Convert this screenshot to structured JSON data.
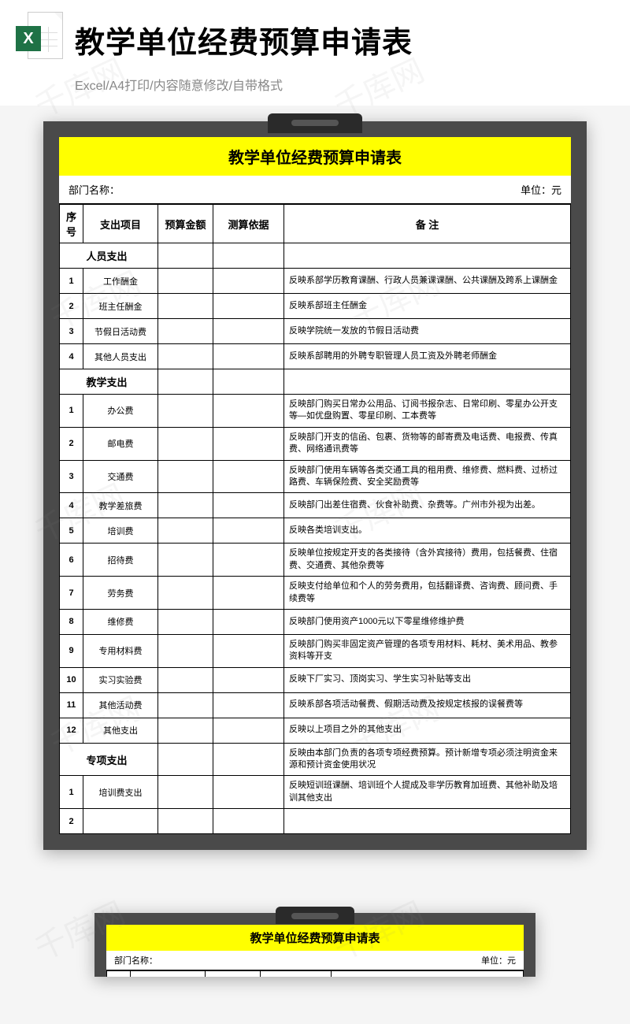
{
  "header": {
    "main_title": "教学单位经费预算申请表",
    "subtitle": "Excel/A4打印/内容随意修改/自带格式",
    "icon_letter": "X"
  },
  "sheet": {
    "title": "教学单位经费预算申请表",
    "dept_label": "部门名称：",
    "unit_label": "单位：元",
    "columns": {
      "num": "序号",
      "item": "支出项目",
      "amount": "预算金额",
      "basis": "测算依据",
      "note": "备  注"
    },
    "sections": [
      {
        "name": "人员支出",
        "note": "",
        "rows": [
          {
            "n": "1",
            "item": "工作酬金",
            "note": "反映系部学历教育课酬、行政人员兼课课酬、公共课酬及跨系上课酬金"
          },
          {
            "n": "2",
            "item": "班主任酬金",
            "note": "反映系部班主任酬金"
          },
          {
            "n": "3",
            "item": "节假日活动费",
            "note": "反映学院统一发放的节假日活动费"
          },
          {
            "n": "4",
            "item": "其他人员支出",
            "note": "反映系部聘用的外聘专职管理人员工资及外聘老师酬金"
          }
        ]
      },
      {
        "name": "教学支出",
        "note": "",
        "rows": [
          {
            "n": "1",
            "item": "办公费",
            "note": "反映部门购买日常办公用品、订阅书报杂志、日常印刷、零星办公开支等—如优盘购置、零星印刷、工本费等"
          },
          {
            "n": "2",
            "item": "邮电费",
            "note": "反映部门开支的信函、包裹、货物等的邮寄费及电话费、电报费、传真费、网络通讯费等"
          },
          {
            "n": "3",
            "item": "交通费",
            "note": "反映部门使用车辆等各类交通工具的租用费、维修费、燃料费、过桥过路费、车辆保险费、安全奖励费等"
          },
          {
            "n": "4",
            "item": "教学差旅费",
            "note": "反映部门出差住宿费、伙食补助费、杂费等。广州市外视为出差。"
          },
          {
            "n": "5",
            "item": "培训费",
            "note": "反映各类培训支出。"
          },
          {
            "n": "6",
            "item": "招待费",
            "note": "反映单位按规定开支的各类接待（含外宾接待）费用，包括餐费、住宿费、交通费、其他杂费等"
          },
          {
            "n": "7",
            "item": "劳务费",
            "note": "反映支付给单位和个人的劳务费用，包括翻译费、咨询费、顾问费、手续费等"
          },
          {
            "n": "8",
            "item": "维修费",
            "note": "反映部门使用资产1000元以下零星维修维护费"
          },
          {
            "n": "9",
            "item": "专用材料费",
            "note": "反映部门购买非固定资产管理的各项专用材料、耗材、美术用品、教参资料等开支"
          },
          {
            "n": "10",
            "item": "实习实验费",
            "note": "反映下厂实习、顶岗实习、学生实习补贴等支出"
          },
          {
            "n": "11",
            "item": "其他活动费",
            "note": "反映系部各项活动餐费、假期活动费及按规定核报的误餐费等"
          },
          {
            "n": "12",
            "item": "其他支出",
            "note": "反映以上项目之外的其他支出"
          }
        ]
      },
      {
        "name": "专项支出",
        "note": "反映由本部门负责的各项专项经费预算。预计新增专项必须注明资金来源和预计资金使用状况",
        "rows": [
          {
            "n": "1",
            "item": "培训费支出",
            "note": "反映短训班课酬、培训班个人提成及非学历教育加班费、其他补助及培训其他支出"
          },
          {
            "n": "2",
            "item": "",
            "note": ""
          }
        ]
      }
    ]
  },
  "watermark_text": "千库网"
}
